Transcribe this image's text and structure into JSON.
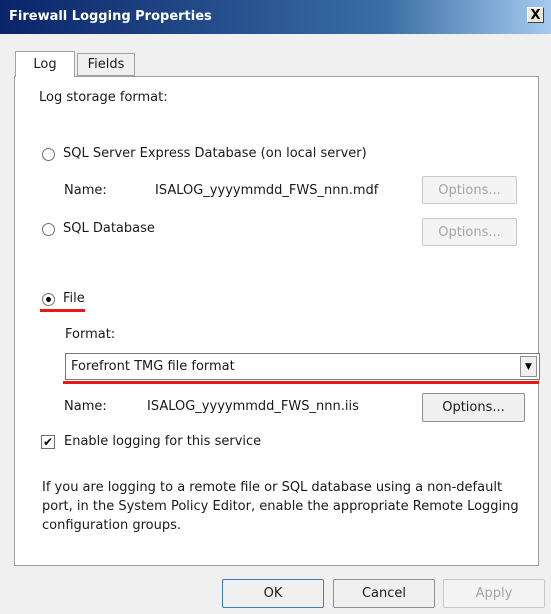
{
  "window": {
    "title": "Firewall Logging Properties",
    "close_glyph": "X"
  },
  "tabs": [
    {
      "label": "Log",
      "active": true
    },
    {
      "label": "Fields",
      "active": false
    }
  ],
  "log": {
    "storage_label": "Log storage format:",
    "sql_express": {
      "label": "SQL Server Express Database (on local server)",
      "name_label": "Name:",
      "name_value": "ISALOG_yyyymmdd_FWS_nnn.mdf",
      "options_label": "Options...",
      "checked": false,
      "options_enabled": false
    },
    "sql_db": {
      "label": "SQL Database",
      "options_label": "Options...",
      "checked": false,
      "options_enabled": false
    },
    "file": {
      "label": "File",
      "checked": true,
      "format_label": "Format:",
      "format_value": "Forefront TMG file format",
      "name_label": "Name:",
      "name_value": "ISALOG_yyyymmdd_FWS_nnn.iis",
      "options_label": "Options...",
      "options_enabled": true
    },
    "enable_logging": {
      "label": "Enable logging for this service",
      "checked": true
    },
    "info_text": "If you are logging to a remote file or SQL database using a non-default port, in the System Policy Editor, enable the appropriate Remote Logging configuration groups."
  },
  "footer": {
    "ok_label": "OK",
    "cancel_label": "Cancel",
    "apply_label": "Apply"
  },
  "icons": {
    "checkbox_mark": "✔",
    "dropdown_arrow": "▼"
  },
  "colors": {
    "highlight_underline": "#e41b17",
    "title_bar": "#0a246a"
  }
}
